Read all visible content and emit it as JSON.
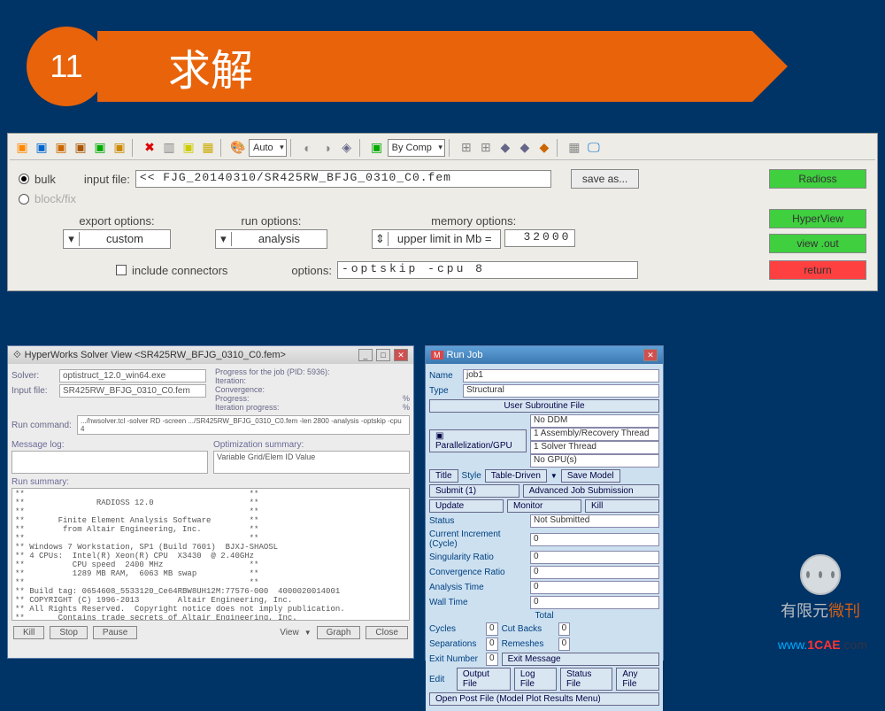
{
  "header": {
    "number": "11",
    "title": "求解"
  },
  "toolbar": {
    "auto": "Auto",
    "bycomp": "By Comp"
  },
  "form": {
    "bulk": "bulk",
    "blockfix": "block/fix",
    "inputfile_lbl": "input file:",
    "inputfile_val": "<< FJG_20140310/SR425RW_BFJG_0310_C0.fem",
    "saveas": "save as...",
    "radioss": "Radioss",
    "export_lbl": "export options:",
    "export_val": "custom",
    "run_lbl": "run options:",
    "run_val": "analysis",
    "mem_lbl": "memory options:",
    "mem_val": "upper limit in Mb =",
    "mem_num": "32000",
    "hyperview": "HyperView",
    "viewout": "view .out",
    "include": "include connectors",
    "options_lbl": "options:",
    "options_val": "-optskip -cpu 8",
    "return": "return"
  },
  "solver": {
    "title": "HyperWorks Solver View <SR425RW_BFJG_0310_C0.fem>",
    "solver_lbl": "Solver:",
    "solver_val": "optistruct_12.0_win64.exe",
    "input_lbl": "Input file:",
    "input_val": "SR425RW_BFJG_0310_C0.fem",
    "progress_lbl": "Progress for the job (PID: 5936):",
    "iteration": "Iteration:",
    "convergence": "Convergence:",
    "progress": "Progress:",
    "progress_pct": "%",
    "iter_progress": "Iteration progress:",
    "runcmd_lbl": "Run command:",
    "runcmd_val": ".../hwsolver.tcl -solver RD -screen .../SR425RW_BFJG_0310_C0.fem -len 2800 -analysis -optskip -cpu 4",
    "msglog": "Message log:",
    "optsum": "Optimization summary:",
    "optcols": "Variable  Grid/Elem ID   Value",
    "runsum": "Run summary:",
    "body": "**                                               **\n**               RADIOSS 12.0                    **\n**                                               **\n**       Finite Element Analysis Software        **\n**        from Altair Engineering, Inc.          **\n**                                               **\n** Windows 7 Workstation, SP1 (Build 7601)  BJXJ-SHAOSL\n** 4 CPUs:  Intel(R) Xeon(R) CPU  X3430  @ 2.40GHz\n**          CPU speed  2400 MHz                  **\n**          1289 MB RAM,  6063 MB swap           **\n**                                               **\n** Build tag: 0654608_5533120_Ce64RBW8UH12M:77576-000  4000020014001\n** COPYRIGHT (C) 1996-2013        Altair Engineering, Inc.\n** All Rights Reserved.  Copyright notice does not imply publication.\n**       Contains trade secrets of Altair Engineering, Inc.\n** Decompilation or disassembly of this software strictly prohibited.",
    "kill": "Kill",
    "stop": "Stop",
    "pause": "Pause",
    "view": "View",
    "close": "Close",
    "graph": "Graph"
  },
  "runjob": {
    "title": "Run Job",
    "name_lbl": "Name",
    "name_val": "job1",
    "type_lbl": "Type",
    "type_val": "Structural",
    "usr": "User Subroutine File",
    "par_lbl": "Parallelization/GPU",
    "ddm": "No DDM",
    "asm": "1 Assembly/Recovery Thread",
    "sol": "1 Solver Thread",
    "gpu": "No GPU(s)",
    "title_btn": "Title",
    "style": "Style",
    "table": "Table-Driven",
    "savemodel": "Save Model",
    "submit": "Submit (1)",
    "adv": "Advanced Job Submission",
    "update": "Update",
    "monitor": "Monitor",
    "killbtn": "Kill",
    "status_lbl": "Status",
    "status_val": "Not Submitted",
    "cur_lbl": "Current Increment (Cycle)",
    "cur_val": "0",
    "sing_lbl": "Singularity Ratio",
    "sing_val": "0",
    "conv_lbl": "Convergence Ratio",
    "conv_val": "0",
    "anal_lbl": "Analysis Time",
    "anal_val": "0",
    "wall_lbl": "Wall Time",
    "wall_val": "0",
    "total": "Total",
    "cycles_lbl": "Cycles",
    "cycles_val": "0",
    "cut_lbl": "Cut Backs",
    "cut_val": "0",
    "sep_lbl": "Separations",
    "sep_val": "0",
    "rem_lbl": "Remeshes",
    "rem_val": "0",
    "exit_lbl": "Exit Number",
    "exit_val": "0",
    "exitmsg": "Exit Message",
    "edit": "Edit",
    "outfile": "Output File",
    "logfile": "Log File",
    "statfile": "Status File",
    "anyfile": "Any File",
    "open": "Open Post File (Model Plot Results Menu)"
  },
  "wm": {
    "text1": "有限元",
    "text2": "微刊",
    "cae_w": "www.",
    "cae_r": "1CAE",
    "cae_c": ".com"
  }
}
